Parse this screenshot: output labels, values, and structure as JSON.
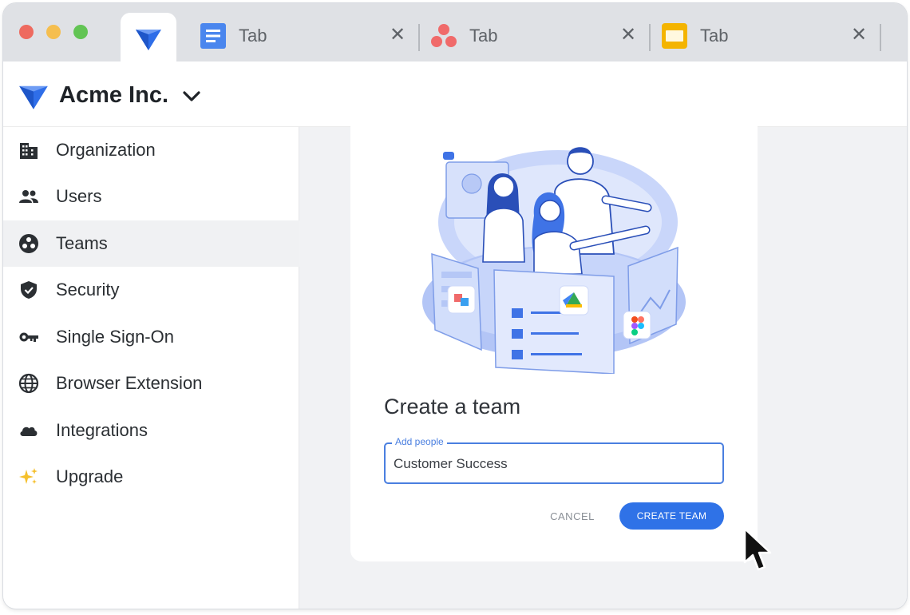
{
  "browser": {
    "tabs": [
      {
        "label": "",
        "icon": "company-logo-icon",
        "active": true
      },
      {
        "label": "Tab",
        "icon": "docs-icon",
        "close": "✕"
      },
      {
        "label": "Tab",
        "icon": "asana-icon",
        "close": "✕"
      },
      {
        "label": "Tab",
        "icon": "slides-icon",
        "close": "✕"
      }
    ]
  },
  "org": {
    "name": "Acme Inc."
  },
  "sidebar": {
    "items": [
      {
        "label": "Organization",
        "icon": "building-icon"
      },
      {
        "label": "Users",
        "icon": "users-icon"
      },
      {
        "label": "Teams",
        "icon": "teams-icon",
        "active": true
      },
      {
        "label": "Security",
        "icon": "shield-icon"
      },
      {
        "label": "Single Sign-On",
        "icon": "key-icon"
      },
      {
        "label": "Browser Extension",
        "icon": "globe-icon"
      },
      {
        "label": "Integrations",
        "icon": "cloud-icon"
      },
      {
        "label": "Upgrade",
        "icon": "sparkle-icon"
      }
    ]
  },
  "dialog": {
    "title": "Create a team",
    "field_label": "Add people",
    "field_value": "Customer Success",
    "cancel_label": "CANCEL",
    "create_label": "CREATE TEAM"
  },
  "colors": {
    "accent": "#2f72e7",
    "brand": "#3a6ee8",
    "illustration": "#a9bdf5",
    "sidebar_active": "#f0f1f3"
  }
}
